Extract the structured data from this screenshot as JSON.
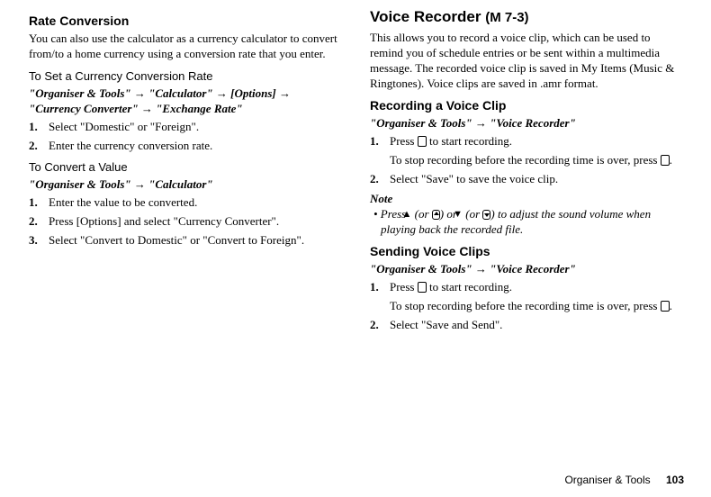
{
  "left": {
    "rate_title": "Rate Conversion",
    "rate_intro": "You can also use the calculator as a currency calculator to convert from/to a home currency using a conversion rate that you enter.",
    "set_rate_title": "To Set a Currency Conversion Rate",
    "set_rate_path": "\"Organiser & Tools\" → \"Calculator\" → [Options] → \"Currency Converter\" → \"Exchange Rate\"",
    "set_rate_steps": [
      "Select \"Domestic\" or \"Foreign\".",
      "Enter the currency conversion rate."
    ],
    "convert_title": "To Convert a Value",
    "convert_path": "\"Organiser & Tools\" → \"Calculator\"",
    "convert_steps": [
      "Enter the value to be converted.",
      "Press [Options] and select \"Currency Converter\".",
      "Select \"Convert to Domestic\" or \"Convert to Foreign\"."
    ]
  },
  "right": {
    "vr_title": "Voice Recorder",
    "vr_menucode": "(M 7-3)",
    "vr_intro": "This allows you to record a voice clip, which can be used to remind you of schedule entries or be sent within a multimedia message. The recorded voice clip is saved in My Items (Music & Ringtones). Voice clips are saved in .amr format.",
    "rec_title": "Recording a Voice Clip",
    "rec_path": "\"Organiser & Tools\" → \"Voice Recorder\"",
    "rec_step1a": "Press ",
    "rec_step1b": " to start recording.",
    "rec_step1_extra_a": "To stop recording before the recording time is over, press ",
    "rec_step1_extra_b": ".",
    "rec_step2": "Select \"Save\" to save the voice clip.",
    "note_label": "Note",
    "note_a": "• Press ",
    "note_b": " (or ",
    "note_c": ") or ",
    "note_d": " (or ",
    "note_e": ") to adjust the sound volume when playing back the recorded file.",
    "send_title": "Sending Voice Clips",
    "send_path": "\"Organiser & Tools\" → \"Voice Recorder\"",
    "send_step1a": "Press ",
    "send_step1b": " to start recording.",
    "send_step1_extra_a": "To stop recording before the recording time is over, press ",
    "send_step1_extra_b": ".",
    "send_step2": "Select \"Save and Send\"."
  },
  "footer": {
    "section": "Organiser & Tools",
    "page": "103"
  }
}
